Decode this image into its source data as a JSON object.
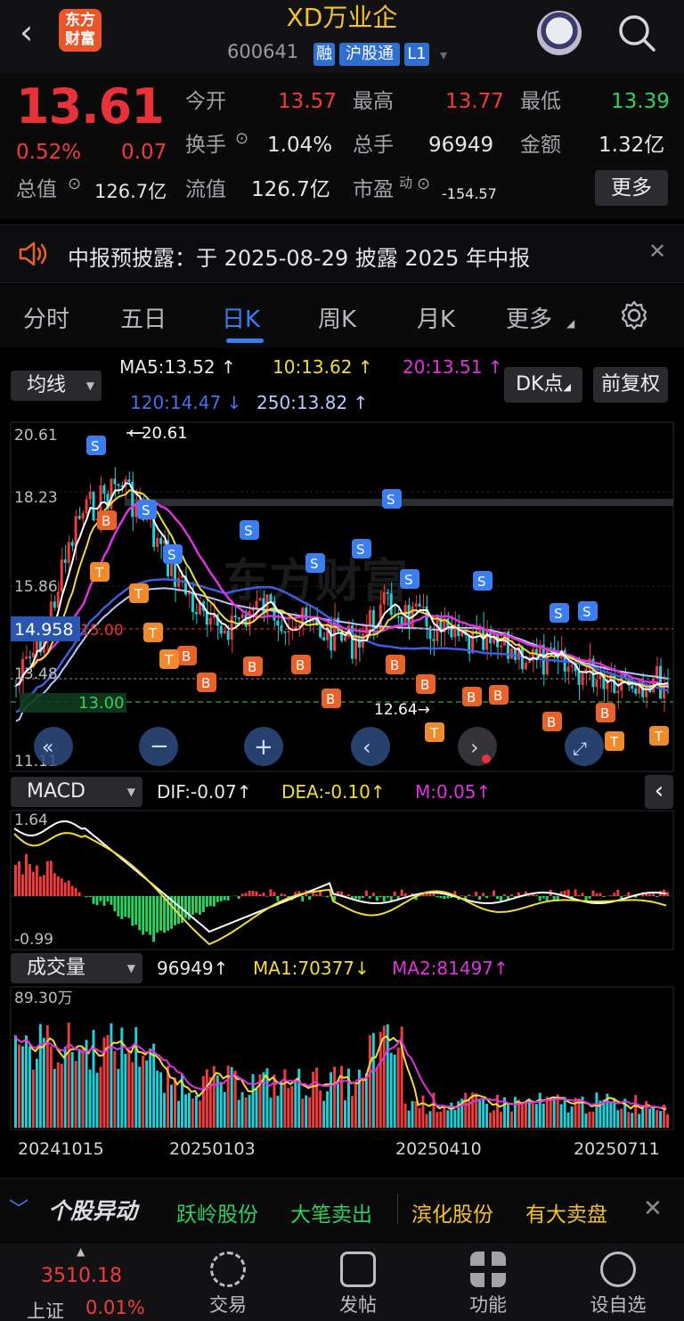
{
  "header": {
    "logo_text": "东方\n财富",
    "stock_name": "XD万业企",
    "stock_code": "600641",
    "tags": [
      "融",
      "沪股通",
      "L1"
    ]
  },
  "quote": {
    "price": "13.61",
    "change_pct": "0.52%",
    "change": "0.07",
    "open_label": "今开",
    "open": "13.57",
    "high_label": "最高",
    "high": "13.77",
    "low_label": "最低",
    "low": "13.39",
    "turnover_label": "换手",
    "turnover": "1.04%",
    "volume_label": "总手",
    "volume": "96949",
    "amount_label": "金额",
    "amount": "1.32亿",
    "mktcap_label": "总值",
    "mktcap": "126.7亿",
    "float_label": "流值",
    "float": "126.7亿",
    "pe_label": "市盈",
    "pe_sup": "动",
    "pe": "-154.57",
    "more": "更多"
  },
  "notice": {
    "text": "中报预披露：于 2025-08-29 披露 2025 年中报"
  },
  "tabs": {
    "items": [
      "分时",
      "五日",
      "日K",
      "周K",
      "月K",
      "更多"
    ],
    "active": "日K"
  },
  "ma": {
    "selector": "均线",
    "ma5": "MA5:13.52",
    "ma10": "10:13.62",
    "ma20": "20:13.51",
    "ma120": "120:14.47",
    "ma250": "250:13.82",
    "dk_btn": "DK点",
    "fq_btn": "前复权"
  },
  "kline": {
    "ylabels": [
      "20.61",
      "18.23",
      "15.86",
      "13.48",
      "11.11"
    ],
    "peak": "20.61",
    "low": "12.64",
    "cost": "14.958",
    "cost_line": "15.00",
    "cost_label": "13.00"
  },
  "macd": {
    "selector": "MACD",
    "dif": "DIF:-0.07",
    "dea": "DEA:-0.10",
    "m": "M:0.05",
    "ymax": "1.64",
    "ymin": "-0.99"
  },
  "vol": {
    "selector": "成交量",
    "val": "96949",
    "ma1": "MA1:70377",
    "ma2": "MA2:81497",
    "ymax": "89.30万",
    "dates": [
      "20241015",
      "20250103",
      "20250410",
      "20250711"
    ]
  },
  "ticker": {
    "title": "个股异动",
    "items": [
      {
        "name": "跃岭股份",
        "event": "大笔卖出"
      },
      {
        "name": "滨化股份",
        "event": "有大卖盘"
      }
    ]
  },
  "nav": {
    "index_value": "3510.18",
    "index_name": "上证",
    "index_pct": "0.01%",
    "items": [
      "交易",
      "发帖",
      "功能",
      "设自选"
    ]
  },
  "colors": {
    "up": "#f03c3c",
    "down": "#2fd060",
    "accent": "#3a7ef0",
    "ma5": "#ffffff",
    "ma10": "#f2dc3c",
    "ma20": "#e032e0",
    "ma120": "#3a5fe0",
    "ma250": "#b8c8ff"
  }
}
